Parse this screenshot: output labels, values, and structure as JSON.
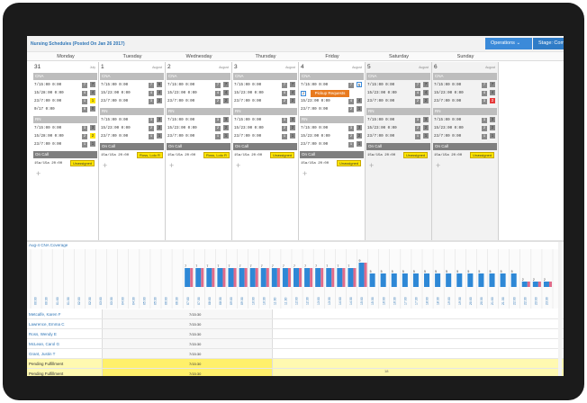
{
  "header": {
    "title": "Nursing Schedules (Posted On Jan 26 2017)",
    "operations_label": "Operations",
    "stage_label": "Stage: Comp"
  },
  "weekdays": [
    "Monday",
    "Tuesday",
    "Wednesday",
    "Thursday",
    "Friday",
    "Saturday",
    "Sunday"
  ],
  "calendar": {
    "days": [
      {
        "number": "31",
        "month": "July",
        "dim": false,
        "sections": [
          {
            "label": "CNA",
            "rows": [
              [
                "7/15:00 0:00",
                "7",
                "7"
              ],
              [
                "15/28:00 0:00",
                "4",
                "4"
              ],
              [
                "23/7:00 0:00",
                "1",
                "1"
              ],
              [
                "0/17 0:00",
                "0",
                "0"
              ]
            ],
            "badges": [
              "g",
              "g",
              "y",
              "g"
            ]
          },
          {
            "label": "RN",
            "rows": [
              [
                "7/15:00 0:00",
                "3",
                "3"
              ],
              [
                "15/28:00 0:00",
                "2",
                "2"
              ],
              [
                "23/7:00 0:00",
                "1",
                "1"
              ]
            ],
            "badges": [
              "g",
              "y",
              "g"
            ]
          }
        ],
        "oncall": {
          "label": "On Call",
          "time": "15a/15a 20:00",
          "assign": "Unassigned"
        }
      },
      {
        "number": "1",
        "month": "August",
        "dim": false,
        "sections": [
          {
            "label": "CNA",
            "rows": [
              [
                "7/15:00 0:00",
                "7",
                "6"
              ],
              [
                "15/23:00 0:00",
                "4",
                "4"
              ],
              [
                "23/7:00 0:00",
                "3",
                "2"
              ]
            ],
            "badges": [
              "g",
              "g",
              "g"
            ]
          },
          {
            "label": "RN",
            "rows": [
              [
                "7/15:00 0:00",
                "3",
                "3"
              ],
              [
                "15/23:00 0:00",
                "2",
                "2"
              ],
              [
                "23/7:00 0:00",
                "1",
                "1"
              ]
            ],
            "badges": [
              "g",
              "g",
              "g"
            ]
          }
        ],
        "oncall": {
          "label": "On Call",
          "time": "15a/15a 20:00",
          "assign": "Ross, Lolo R"
        }
      },
      {
        "number": "2",
        "month": "August",
        "dim": false,
        "sections": [
          {
            "label": "CNA",
            "rows": [
              [
                "7/15:00 0:00",
                "7",
                "7"
              ],
              [
                "15/23:00 0:00",
                "4",
                "4"
              ],
              [
                "23/7:00 0:00",
                "2",
                "2"
              ]
            ],
            "badges": [
              "g",
              "g",
              "g"
            ]
          },
          {
            "label": "RN",
            "rows": [
              [
                "7/15:00 0:00",
                "3",
                "3"
              ],
              [
                "15/23:00 0:00",
                "2",
                "2"
              ],
              [
                "23/7:00 0:00",
                "1",
                "1"
              ]
            ],
            "badges": [
              "g",
              "g",
              "g"
            ]
          }
        ],
        "oncall": {
          "label": "On Call",
          "time": "15a/15a 20:00",
          "assign": "Ross, Lolo R"
        }
      },
      {
        "number": "3",
        "month": "August",
        "dim": false,
        "sections": [
          {
            "label": "CNA",
            "rows": [
              [
                "7/15:00 0:00",
                "7",
                "7"
              ],
              [
                "15/23:00 0:00",
                "4",
                "4"
              ],
              [
                "23/7:00 0:00",
                "2",
                "2"
              ]
            ],
            "badges": [
              "g",
              "g",
              "g"
            ]
          },
          {
            "label": "RN",
            "rows": [
              [
                "7/15:00 0:00",
                "3",
                "3"
              ],
              [
                "15/23:00 0:00",
                "2",
                "2"
              ],
              [
                "23/7:00 0:00",
                "1",
                "1"
              ]
            ],
            "badges": [
              "g",
              "g",
              "g"
            ]
          }
        ],
        "oncall": {
          "label": "On Call",
          "time": "15a/15a 20:00",
          "assign": "Unassigned"
        }
      },
      {
        "number": "4",
        "month": "August",
        "dim": false,
        "sections": [
          {
            "label": "CNA",
            "rows": [
              [
                "7/15:00 0:00",
                "7",
                "5"
              ],
              [
                "15/23:00 0:00",
                "4",
                "4"
              ],
              [
                "23/7:00 0:00",
                "2",
                "1"
              ]
            ],
            "badges": [
              "o",
              "g",
              "g"
            ]
          },
          {
            "label": "RN",
            "rows": [
              [
                "7/15:00 0:00",
                "3",
                "3"
              ],
              [
                "15/23:00 0:00",
                "2",
                "2"
              ],
              [
                "23/7:00 0:00",
                "1",
                "1"
              ]
            ],
            "badges": [
              "g",
              "g",
              "g"
            ]
          }
        ],
        "pickup": {
          "count": "2",
          "label": "Pickup Requests"
        },
        "oncall": {
          "label": "On Call",
          "time": "15a/15a 20:00",
          "assign": "Unassigned"
        }
      },
      {
        "number": "5",
        "month": "August",
        "dim": true,
        "sections": [
          {
            "label": "CNA",
            "rows": [
              [
                "7/15:00 0:00",
                "7",
                "7"
              ],
              [
                "15/23:00 0:00",
                "4",
                "4"
              ],
              [
                "23/7:00 0:00",
                "2",
                "2"
              ]
            ],
            "badges": [
              "g",
              "g",
              "g"
            ]
          },
          {
            "label": "RN",
            "rows": [
              [
                "7/15:00 0:00",
                "3",
                "3"
              ],
              [
                "15/23:00 0:00",
                "2",
                "2"
              ],
              [
                "23/7:00 0:00",
                "1",
                "1"
              ]
            ],
            "badges": [
              "g",
              "g",
              "g"
            ]
          }
        ],
        "oncall": {
          "label": "On Call",
          "time": "15a/15a 20:00",
          "assign": "Unassigned"
        }
      },
      {
        "number": "6",
        "month": "August",
        "dim": true,
        "sections": [
          {
            "label": "CNA",
            "rows": [
              [
                "7/15:00 0:00",
                "7",
                "7"
              ],
              [
                "15/23:00 0:00",
                "4",
                "4"
              ],
              [
                "23/7:00 0:00",
                "3",
                "2"
              ]
            ],
            "badges": [
              "g",
              "g",
              "r"
            ]
          },
          {
            "label": "RN",
            "rows": [
              [
                "7/15:00 0:00",
                "3",
                "3"
              ],
              [
                "15/23:00 0:00",
                "2",
                "2"
              ],
              [
                "23/7:00 0:00",
                "1",
                "1"
              ]
            ],
            "badges": [
              "g",
              "g",
              "g"
            ]
          }
        ],
        "oncall": {
          "label": "On Call",
          "time": "15a/15a 20:00",
          "assign": "Unassigned"
        }
      }
    ]
  },
  "coverage": {
    "title": "Aug-4 CNA Coverage",
    "people": [
      {
        "name": "Metcalfe, Karen F",
        "shift": "7/15:30",
        "pending": false
      },
      {
        "name": "Lawrence, Emma C",
        "shift": "7/15:30",
        "pending": false
      },
      {
        "name": "Ross, Wendy E",
        "shift": "7/15:30",
        "pending": false
      },
      {
        "name": "McLean, Carol G",
        "shift": "7/15:30",
        "pending": false
      },
      {
        "name": "Grant, Justin T",
        "shift": "7/15:30",
        "pending": false
      },
      {
        "name": "Pending Fulfillment",
        "shift": "7/15:30",
        "pending": true
      },
      {
        "name": "Pending Fulfillment",
        "shift": "7/15:30",
        "pending": true
      }
    ]
  },
  "colors": {
    "primary": "#3b8ad9",
    "bar_blue": "#2e88d6",
    "bar_pink": "#e06b8a",
    "yellow": "#ffe500",
    "orange": "#e87a1e",
    "red": "#e53a3a"
  },
  "chart_data": {
    "type": "bar",
    "categories": [
      "00:00",
      "00:30",
      "01:00",
      "01:30",
      "02:00",
      "02:30",
      "03:00",
      "03:30",
      "04:00",
      "04:30",
      "05:00",
      "05:30",
      "06:00",
      "06:30",
      "07:00",
      "07:30",
      "08:00",
      "08:30",
      "09:00",
      "09:30",
      "10:00",
      "10:30",
      "11:00",
      "11:30",
      "12:00",
      "12:30",
      "13:00",
      "13:30",
      "14:00",
      "14:30",
      "15:00",
      "15:30",
      "16:00",
      "16:30",
      "17:00",
      "17:30",
      "18:00",
      "18:30",
      "19:00",
      "19:30",
      "20:00",
      "20:30",
      "21:00",
      "21:30",
      "22:00",
      "22:30",
      "23:00",
      "23:30"
    ],
    "series": [
      {
        "values": [
          0,
          0,
          0,
          0,
          0,
          0,
          0,
          0,
          0,
          0,
          0,
          0,
          0,
          0,
          7,
          7,
          7,
          7,
          7,
          7,
          7,
          7,
          7,
          7,
          7,
          7,
          7,
          7,
          7,
          7,
          9,
          5,
          5,
          5,
          5,
          5,
          5,
          5,
          5,
          5,
          5,
          5,
          5,
          5,
          5,
          2,
          2,
          2
        ]
      },
      {
        "values": [
          0,
          0,
          0,
          0,
          0,
          0,
          0,
          0,
          0,
          0,
          0,
          0,
          0,
          0,
          7,
          7,
          7,
          7,
          7,
          7,
          7,
          7,
          7,
          7,
          7,
          7,
          7,
          7,
          7,
          7,
          9,
          0,
          0,
          0,
          0,
          0,
          0,
          0,
          0,
          0,
          0,
          0,
          0,
          0,
          0,
          2,
          2,
          2
        ]
      }
    ],
    "ylim": [
      0,
      10
    ]
  },
  "page_number": "18"
}
